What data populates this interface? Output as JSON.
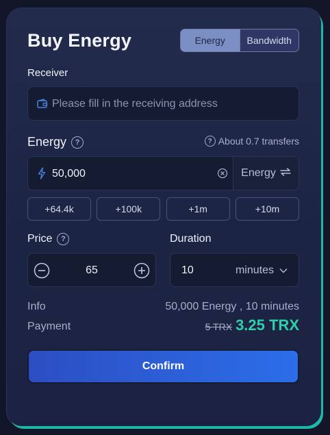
{
  "header": {
    "title": "Buy Energy",
    "tabs": [
      {
        "label": "Energy",
        "active": true
      },
      {
        "label": "Bandwidth",
        "active": false
      }
    ]
  },
  "receiver": {
    "label": "Receiver",
    "placeholder": "Please fill in the receiving address",
    "icon": "wallet-icon"
  },
  "energy": {
    "label": "Energy",
    "hint": "About 0.7 transfers",
    "value": "50,000",
    "unit": "Energy",
    "quick_amounts": [
      "+64.4k",
      "+100k",
      "+1m",
      "+10m"
    ]
  },
  "price": {
    "label": "Price",
    "value": "65"
  },
  "duration": {
    "label": "Duration",
    "value": "10",
    "unit": "minutes"
  },
  "summary": {
    "info_label": "Info",
    "info_value": "50,000 Energy , 10 minutes",
    "payment_label": "Payment",
    "payment_original": "5 TRX",
    "payment_final": "3.25 TRX"
  },
  "actions": {
    "confirm_label": "Confirm"
  },
  "colors": {
    "accent_teal": "#2fcfa8",
    "confirm_start": "#2c4ec2",
    "confirm_end": "#2b6ee9",
    "active_tab": "#7c8fc4"
  }
}
